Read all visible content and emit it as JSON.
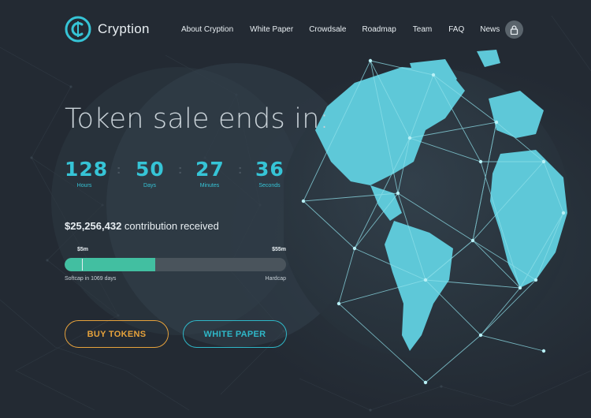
{
  "brand": {
    "name": "Cryption",
    "logo_icon": "cent-coin-logo",
    "accent": "#36c4d6"
  },
  "nav": {
    "items": [
      "About Cryption",
      "White Paper",
      "Crowdsale",
      "Roadmap",
      "Team",
      "FAQ",
      "News"
    ],
    "lock_icon": "lock-icon"
  },
  "hero": {
    "title": "Token sale ends in:"
  },
  "countdown": [
    {
      "value": "128",
      "label": "Hours"
    },
    {
      "value": "50",
      "label": "Days"
    },
    {
      "value": "27",
      "label": "Minutes"
    },
    {
      "value": "36",
      "label": "Seconds"
    }
  ],
  "contribution": {
    "amount": "$25,256,432",
    "text": "contribution received"
  },
  "progress": {
    "softcap_value": "$5m",
    "hardcap_value": "$55m",
    "softcap_label": "Softcap in 1069 days",
    "hardcap_label": "Hardcap",
    "fill_fraction": 0.41
  },
  "buttons": {
    "buy": "BUY TOKENS",
    "white_paper": "WHITE PAPER"
  },
  "colors": {
    "background": "#232a33",
    "primary": "#36c4d6",
    "progress_fill": "#42bfa1",
    "buy": "#e6a23c"
  }
}
